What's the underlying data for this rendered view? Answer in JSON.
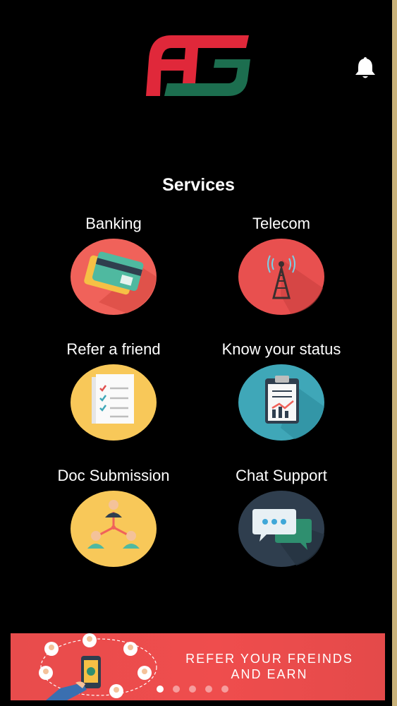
{
  "app": {
    "logo_text": "FG",
    "notification_icon": "bell-icon"
  },
  "services": {
    "title": "Services",
    "items": [
      {
        "label": "Banking",
        "icon": "credit-card-icon",
        "color": "#f0625a"
      },
      {
        "label": "Telecom",
        "icon": "tower-icon",
        "color": "#e8504f"
      },
      {
        "label": "Refer a friend",
        "icon": "checklist-icon",
        "color": "#f8c859"
      },
      {
        "label": "Know your status",
        "icon": "clipboard-chart-icon",
        "color": "#3fa7b8"
      },
      {
        "label": "Doc Submission",
        "icon": "network-people-icon",
        "color": "#f8c859"
      },
      {
        "label": "Chat Support",
        "icon": "chat-bubbles-icon",
        "color": "#2f3e4e"
      }
    ]
  },
  "banner": {
    "line1": "REFER YOUR FREINDS",
    "line2": "AND EARN",
    "color": "#e84c4c",
    "slides": 5,
    "active_slide": 1
  }
}
